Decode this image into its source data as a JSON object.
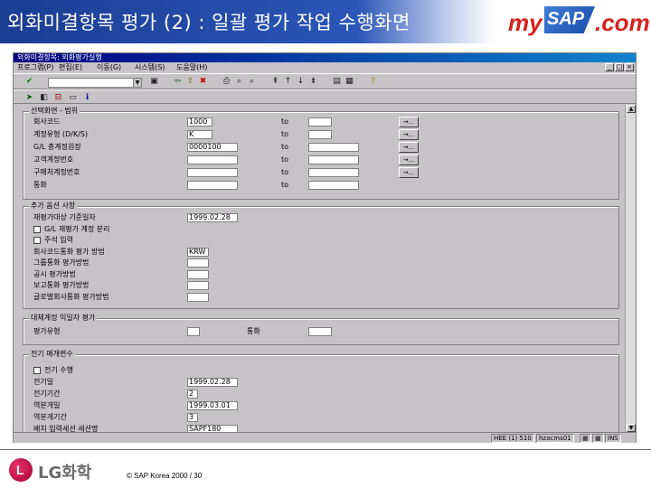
{
  "slide": {
    "title": "외화미결항목 평가 (2) : 일괄 평가 작업 수행화면",
    "logo_my": "my",
    "logo_sap": "SAP",
    "logo_com": ".com",
    "company": "LG화학",
    "copyright": "© SAP Korea 2000 / 30"
  },
  "window": {
    "title": "외화미결항목: 외화평가실행",
    "menu": [
      "프로그램(P)",
      "편집(E)",
      "이동(G)",
      "시스템(S)",
      "도움말(H)"
    ],
    "win_buttons": [
      "_",
      "□",
      "×"
    ]
  },
  "selection": {
    "title": "선택화면 - 범위",
    "to_label": "to",
    "more_label": "→...",
    "rows": [
      {
        "label": "회사코드",
        "from": "1000",
        "to": ""
      },
      {
        "label": "계정유형 (D/K/S)",
        "from": "K",
        "to": ""
      },
      {
        "label": "G/L 총계정원장",
        "from": "0000100",
        "to": ""
      },
      {
        "label": "고객계정번호",
        "from": "",
        "to": ""
      },
      {
        "label": "구매처계정번호",
        "from": "",
        "to": ""
      },
      {
        "label": "통화",
        "from": "",
        "to": ""
      }
    ]
  },
  "params": {
    "title": "추가 옵션 사항",
    "rows": [
      {
        "kind": "field",
        "label": "재평가대상 기준일자",
        "value": "1999.02.28"
      },
      {
        "kind": "check",
        "label": "G/L 재평가 계정 분리"
      },
      {
        "kind": "check",
        "label": "주석 입력"
      },
      {
        "kind": "field",
        "label": "회사코드통화 평가 방법",
        "value": "KRW"
      },
      {
        "kind": "field",
        "label": "그룹통화 평가방법",
        "value": ""
      },
      {
        "kind": "field",
        "label": "공시 평가방법",
        "value": ""
      },
      {
        "kind": "field",
        "label": "보고통화 평가방법",
        "value": ""
      },
      {
        "kind": "field",
        "label": "글로벌회사통화 평가방법",
        "value": ""
      }
    ]
  },
  "valuation": {
    "title": "대체계정 익일자 평가",
    "rate_label": "평가유형",
    "rate_value": "",
    "currency_label": "통화",
    "currency_value": ""
  },
  "posting": {
    "title": "전기 매개변수",
    "check_label": "전기 수행",
    "rows": [
      {
        "label": "전기일",
        "value": "1999.02.28"
      },
      {
        "label": "전기기간",
        "value": "2"
      },
      {
        "label": "역분개일",
        "value": "1999.03.01"
      },
      {
        "label": "역분개기간",
        "value": "3"
      },
      {
        "label": "배치 입력세션 세션명",
        "value": "SAPF180"
      }
    ]
  },
  "status": {
    "system": "HEE (1) 510",
    "server": "hzacms01",
    "mode": "INS"
  }
}
